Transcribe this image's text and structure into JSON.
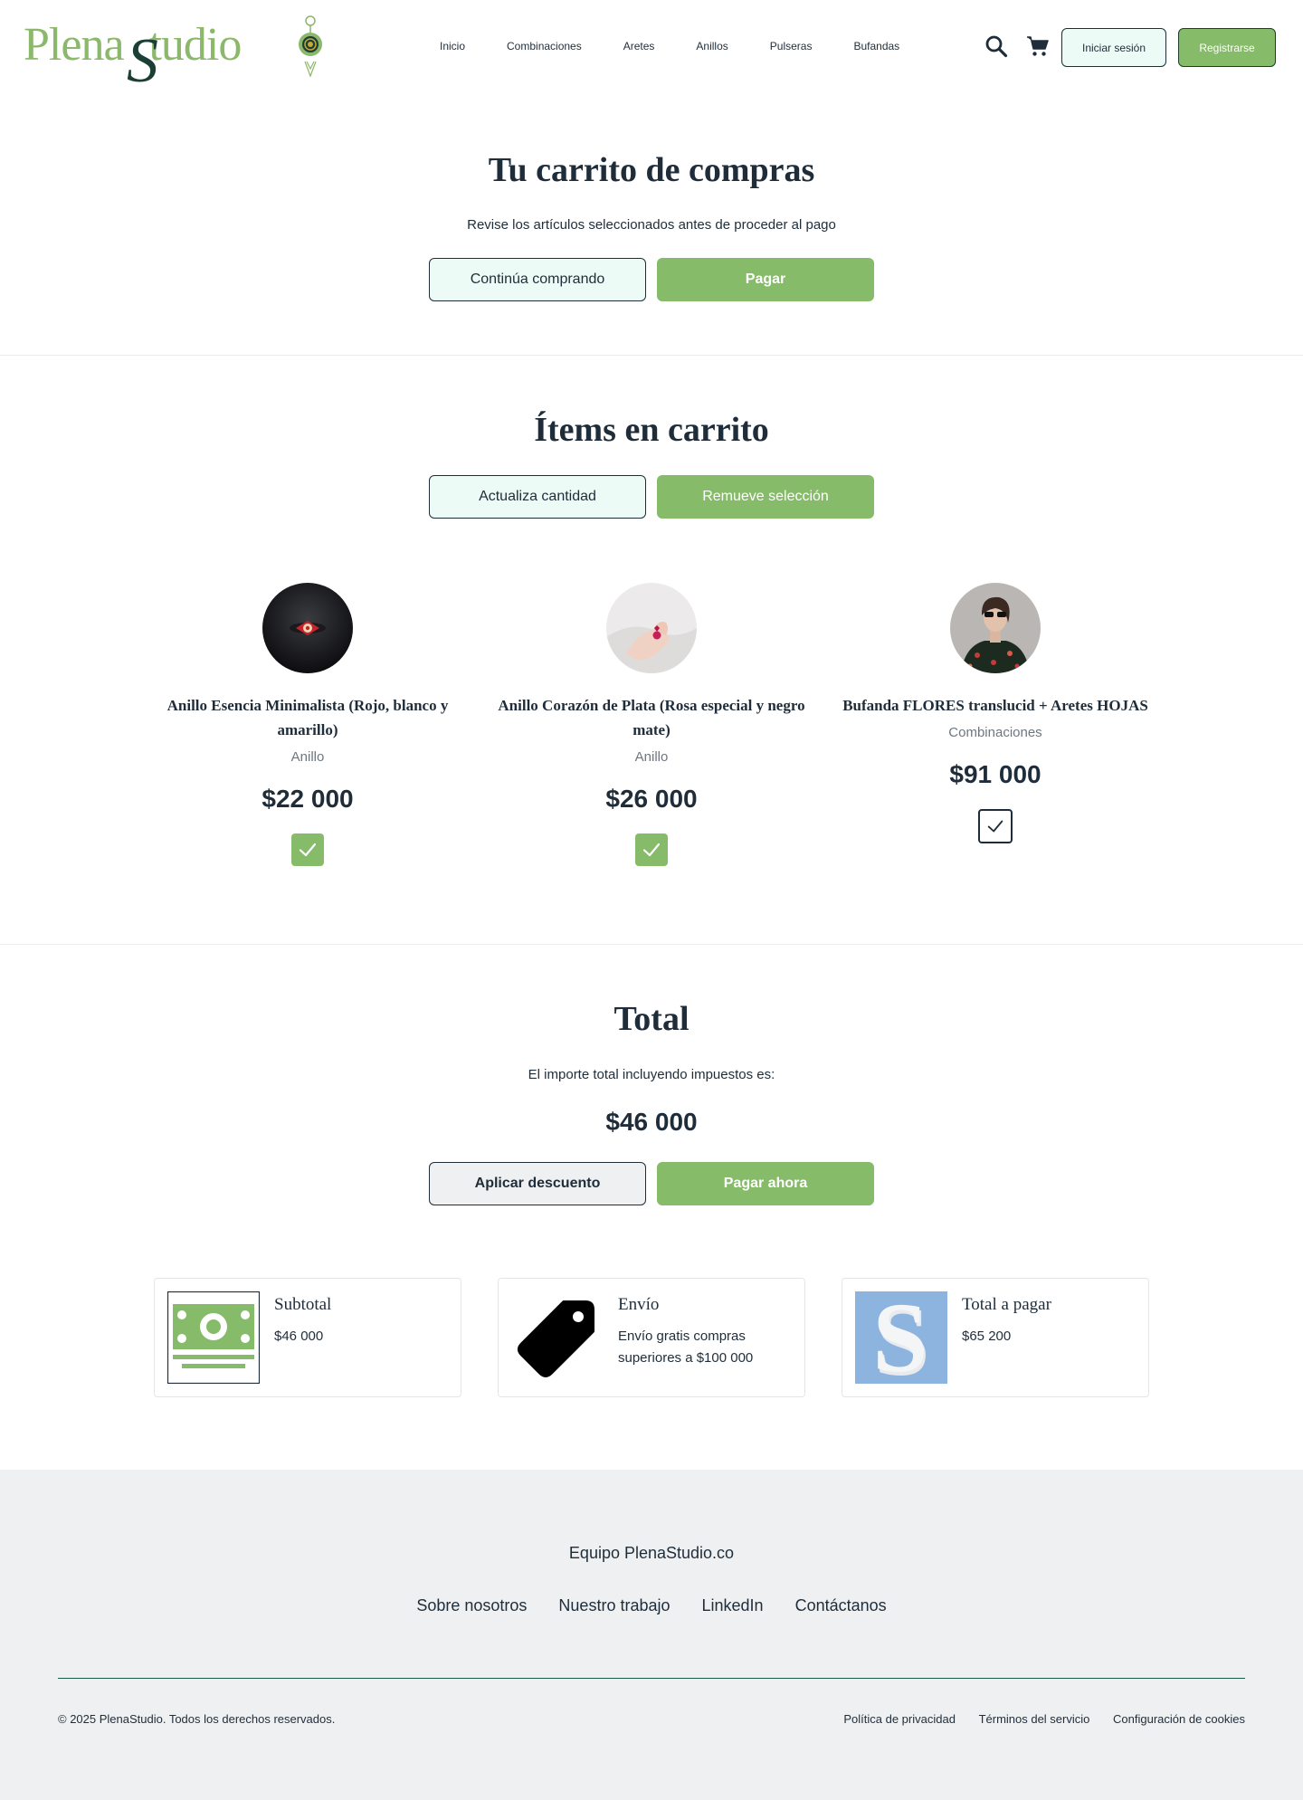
{
  "brand": {
    "name_part1": "Plena",
    "name_part2": "S",
    "name_part3": "tudio"
  },
  "nav": {
    "items": [
      "Inicio",
      "Combinaciones",
      "Aretes",
      "Anillos",
      "Pulseras",
      "Bufandas"
    ]
  },
  "header": {
    "login_label": "Iniciar sesión",
    "register_label": "Registrarse",
    "search_icon": "search-icon",
    "cart_icon": "cart-icon"
  },
  "hero": {
    "title": "Tu carrito de compras",
    "subtitle": "Revise los artículos seleccionados antes de proceder al pago",
    "continue_label": "Continúa comprando",
    "pay_label": "Pagar"
  },
  "cart": {
    "title": "Ítems en carrito",
    "update_label": "Actualiza cantidad",
    "remove_label": "Remueve selección",
    "items": [
      {
        "name": "Anillo Esencia Minimalista (Rojo, blanco y amarillo)",
        "category": "Anillo",
        "price": "$22 000",
        "selected": true
      },
      {
        "name": "Anillo Corazón de Plata (Rosa especial y negro mate)",
        "category": "Anillo",
        "price": "$26 000",
        "selected": true
      },
      {
        "name": "Bufanda FLORES translucid + Aretes HOJAS",
        "category": "Combinaciones",
        "price": "$91 000",
        "selected": false
      }
    ]
  },
  "total": {
    "title": "Total",
    "caption": "El importe total incluyendo impuestos es:",
    "amount": "$46 000",
    "discount_label": "Aplicar descuento",
    "pay_now_label": "Pagar ahora"
  },
  "summary": [
    {
      "title": "Subtotal",
      "text": "$46 000",
      "icon": "money-icon"
    },
    {
      "title": "Envío",
      "text": "Envío gratis compras superiores a $100 000",
      "icon": "tag-icon"
    },
    {
      "title": "Total a pagar",
      "text": "$65 200",
      "icon": "s-logo-icon"
    }
  ],
  "footer": {
    "team": "Equipo PlenaStudio.co",
    "links": [
      "Sobre nosotros",
      "Nuestro trabajo",
      "LinkedIn",
      "Contáctanos"
    ],
    "copyright": "© 2025 PlenaStudio. Todos los derechos reservados.",
    "legal": [
      "Política de privacidad",
      "Términos del servicio",
      "Configuración de cookies"
    ]
  },
  "colors": {
    "accent": "#86bb69",
    "dark": "#1f2d3a",
    "light": "#ecfbf5",
    "brand_dark": "#1b3f34"
  }
}
